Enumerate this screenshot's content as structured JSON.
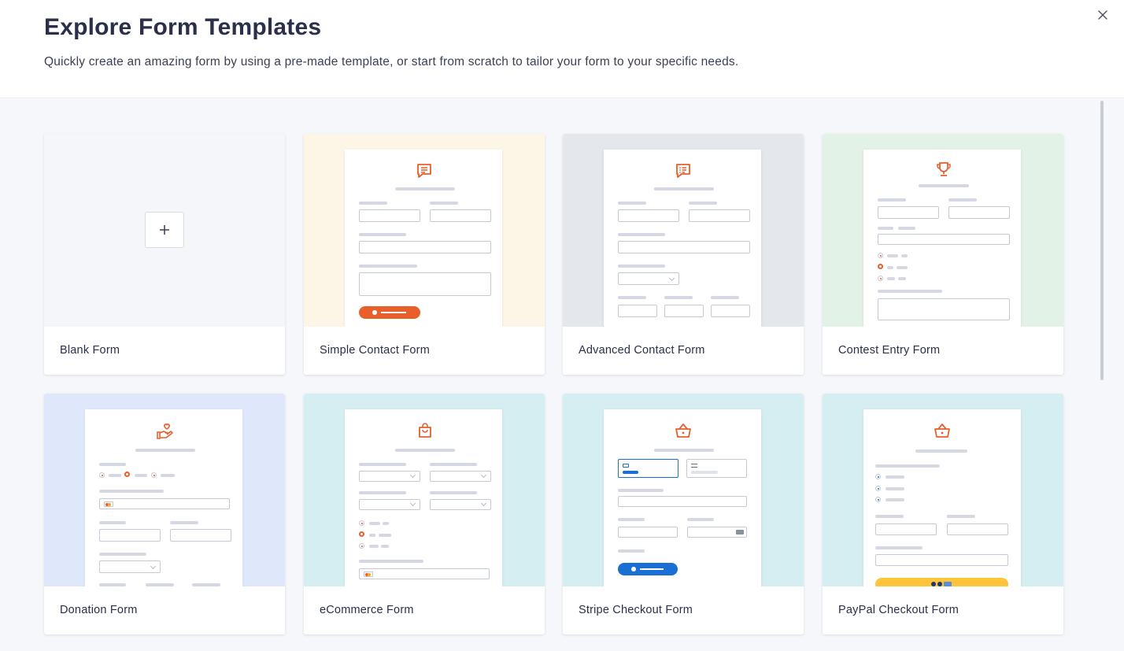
{
  "header": {
    "title": "Explore Form Templates",
    "subtitle": "Quickly create an amazing form by using a pre-made template, or start from scratch to tailor your form to your specific needs."
  },
  "icons": {
    "close": "close-icon",
    "plus": "plus-icon"
  },
  "colors": {
    "accent": "#e85f2b",
    "stripe_blue": "#1a6fd4",
    "paypal_yellow": "#ffc43a"
  },
  "templates": [
    {
      "label": "Blank Form",
      "icon": "plus-icon"
    },
    {
      "label": "Simple Contact Form",
      "icon": "chat-icon"
    },
    {
      "label": "Advanced Contact Form",
      "icon": "chat-list-icon"
    },
    {
      "label": "Contest Entry Form",
      "icon": "trophy-icon"
    },
    {
      "label": "Donation Form",
      "icon": "heart-hand-icon"
    },
    {
      "label": "eCommerce Form",
      "icon": "shopping-bag-icon"
    },
    {
      "label": "Stripe Checkout Form",
      "icon": "basket-icon"
    },
    {
      "label": "PayPal Checkout Form",
      "icon": "basket-icon"
    }
  ]
}
